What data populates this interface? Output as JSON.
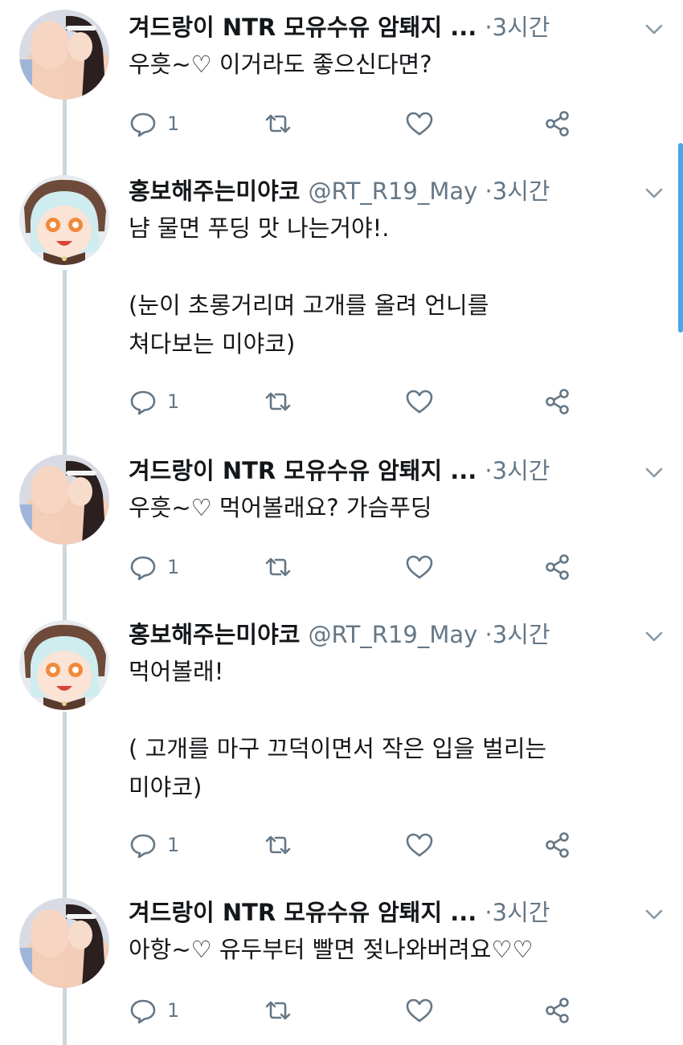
{
  "colors": {
    "name": "#14171a",
    "meta": "#657786",
    "thread_line": "#ccd6dd",
    "scroll_indicator": "#4aa6e8"
  },
  "icons": {
    "reply": "reply-icon",
    "retweet": "retweet-icon",
    "like": "heart-icon",
    "share": "share-icon",
    "more": "chevron-down-icon"
  },
  "tweets": [
    {
      "name": "겨드랑이 NTR 모유수유 암퇘지 ...",
      "handle": "",
      "separator": "·",
      "time": "3시간",
      "text": "우흣~♡ 이거라도 좋으신다면?",
      "reply_count": "1"
    },
    {
      "name": "홍보해주는미야코",
      "handle": "@RT_R19_May",
      "separator": "·",
      "time": "3시간",
      "text": "냠 물면 푸딩 맛 나는거야!.\n\n(눈이 초롱거리며 고개를 올려 언니를\n쳐다보는 미야코)",
      "reply_count": "1"
    },
    {
      "name": "겨드랑이 NTR 모유수유 암퇘지 ...",
      "handle": "",
      "separator": "·",
      "time": "3시간",
      "text": "우흣~♡ 먹어볼래요? 가슴푸딩",
      "reply_count": "1"
    },
    {
      "name": "홍보해주는미야코",
      "handle": "@RT_R19_May",
      "separator": "·",
      "time": "3시간",
      "text": "먹어볼래!\n\n( 고개를 마구 끄덕이면서 작은 입을 벌리는\n미야코)",
      "reply_count": "1"
    },
    {
      "name": "겨드랑이 NTR 모유수유 암퇘지 ...",
      "handle": "",
      "separator": "·",
      "time": "3시간",
      "text": "아항~♡ 유두부터 빨면 젖나와버려요♡♡",
      "reply_count": "1"
    }
  ]
}
